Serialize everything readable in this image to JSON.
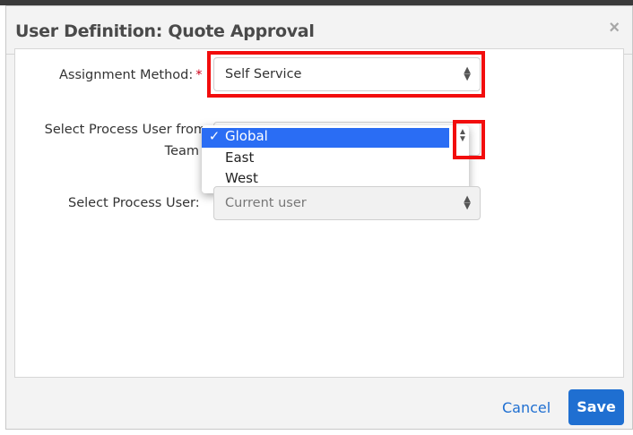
{
  "dialog": {
    "title": "User Definition: Quote Approval",
    "close_icon": "×"
  },
  "form": {
    "assignment_method": {
      "label": "Assignment Method:",
      "required_marker": "*",
      "value": "Self Service"
    },
    "process_user_from_team": {
      "label_line1": "Select Process User from",
      "label_line2": "Team",
      "options": [
        "Global",
        "East",
        "West"
      ],
      "selected": "Global",
      "check_mark": "✓"
    },
    "process_user": {
      "label": "Select Process User:",
      "value": "Current user"
    }
  },
  "footer": {
    "cancel_label": "Cancel",
    "save_label": "Save"
  },
  "colors": {
    "accent": "#1f6fd1",
    "highlight": "#f20d0d",
    "selected_option": "#2a6df4",
    "required": "#d0021b"
  }
}
